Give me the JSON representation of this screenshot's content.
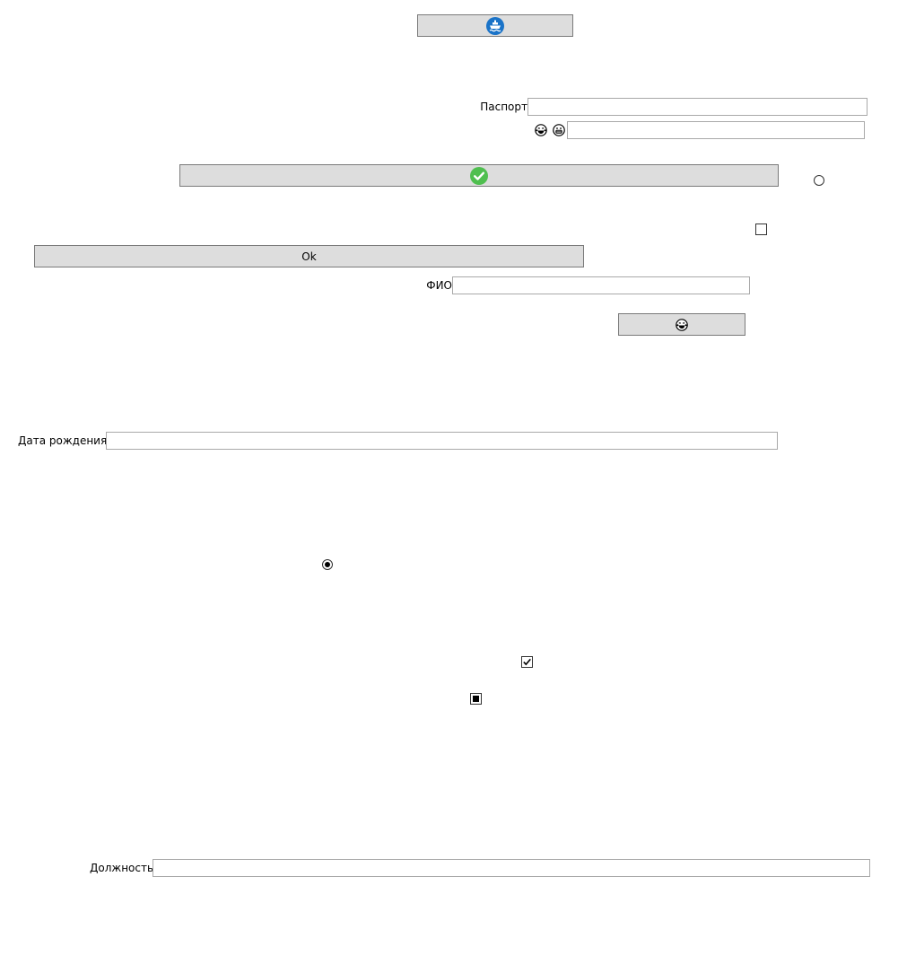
{
  "buttons": {
    "top_icon": "ship-icon",
    "wide_icon": "check-circle-icon",
    "ok_label": "Ok",
    "small_icon": "laugh-tears-icon"
  },
  "fields": {
    "passport_label": "Паспорт",
    "passport_value": "",
    "emoji_row_icons": [
      "laugh-tears-icon",
      "grin-icon"
    ],
    "emoji_value": "",
    "fio_label": "ФИО",
    "fio_value": "",
    "birth_label": "Дата рождения",
    "birth_value": "",
    "position_label": "Должность",
    "position_value": ""
  },
  "controls": {
    "radio_top_checked": false,
    "checkbox_top_checked": false,
    "radio_mid_checked": true,
    "checkbox_checked_state": "checked",
    "checkbox_indeterminate_state": "indeterminate"
  },
  "colors": {
    "button_bg": "#dddddd",
    "button_border": "#7a7a7a",
    "ship_blue": "#1a73c8",
    "check_green": "#4fbf4f"
  }
}
